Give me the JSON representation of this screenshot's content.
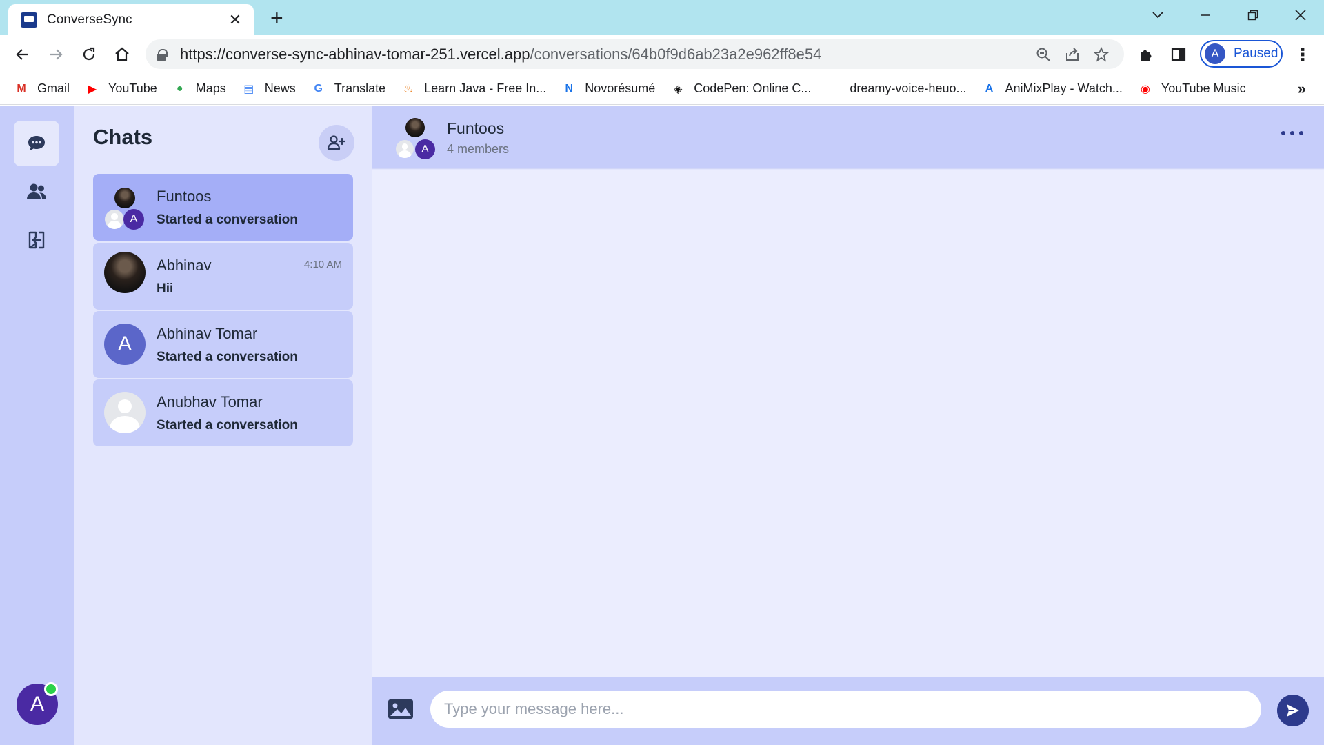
{
  "browser": {
    "tab_title": "ConverseSync",
    "tab_close": "✕",
    "new_tab": "+",
    "url_host": "https://converse-sync-abhinav-tomar-251.vercel.app",
    "url_path": "/conversations/64b0f9d6ab23a2e962ff8e54",
    "profile_initial": "A",
    "profile_status": "Paused",
    "bookmarks": [
      {
        "label": "Gmail",
        "icon": "gmail-icon",
        "glyph": "M",
        "color": "#d93025"
      },
      {
        "label": "YouTube",
        "icon": "youtube-icon",
        "glyph": "▶",
        "color": "#ff0000"
      },
      {
        "label": "Maps",
        "icon": "maps-icon",
        "glyph": "●",
        "color": "#34a853"
      },
      {
        "label": "News",
        "icon": "news-icon",
        "glyph": "▤",
        "color": "#4285f4"
      },
      {
        "label": "Translate",
        "icon": "translate-icon",
        "glyph": "G",
        "color": "#4285f4"
      },
      {
        "label": "Learn Java - Free In...",
        "icon": "java-icon",
        "glyph": "♨",
        "color": "#e76f00"
      },
      {
        "label": "Novorésumé",
        "icon": "novoresume-icon",
        "glyph": "N",
        "color": "#1a73e8"
      },
      {
        "label": "CodePen: Online C...",
        "icon": "codepen-icon",
        "glyph": "◈",
        "color": "#111111"
      },
      {
        "label": "dreamy-voice-heuo...",
        "icon": "blank-icon",
        "glyph": "",
        "color": "#ffffff"
      },
      {
        "label": "AniMixPlay - Watch...",
        "icon": "animixplay-icon",
        "glyph": "A",
        "color": "#1a73e8"
      },
      {
        "label": "YouTube Music",
        "icon": "youtube-music-icon",
        "glyph": "◉",
        "color": "#ff0000"
      }
    ],
    "bookmarks_more": "»"
  },
  "app": {
    "chats_title": "Chats",
    "current_user_initial": "A",
    "chats": [
      {
        "name": "Funtoos",
        "subtitle": "Started a conversation",
        "time": "",
        "avatar": "group",
        "group_letter": "A"
      },
      {
        "name": "Abhinav",
        "subtitle": "Hii",
        "time": "4:10 AM",
        "avatar": "photo"
      },
      {
        "name": "Abhinav Tomar",
        "subtitle": "Started a conversation",
        "time": "",
        "avatar": "letter",
        "letter": "A"
      },
      {
        "name": "Anubhav Tomar",
        "subtitle": "Started a conversation",
        "time": "",
        "avatar": "blank"
      }
    ],
    "conversation": {
      "title": "Funtoos",
      "members": "4 members",
      "group_letter": "A"
    },
    "composer": {
      "placeholder": "Type your message here..."
    },
    "colors": {
      "rail": "#c6cdfa",
      "panel": "#e3e6fd",
      "selected_chat": "#a4aef7",
      "accent": "#2d3a8c",
      "online": "#2bd24a"
    }
  }
}
